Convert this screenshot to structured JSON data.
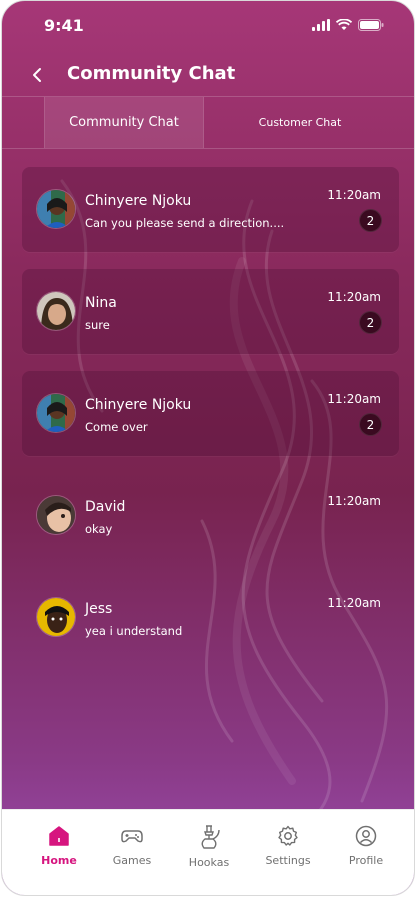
{
  "status": {
    "time": "9:41"
  },
  "header": {
    "title": "Community Chat"
  },
  "tabs": [
    {
      "label": "Community Chat",
      "active": true
    },
    {
      "label": "Customer Chat",
      "active": false
    }
  ],
  "chats": [
    {
      "name": "Chinyere Njoku",
      "message": "Can you please send a direction....",
      "time": "11:20am",
      "unread": "2"
    },
    {
      "name": "Nina",
      "message": "sure",
      "time": "11:20am",
      "unread": "2"
    },
    {
      "name": "Chinyere Njoku",
      "message": "Come  over",
      "time": "11:20am",
      "unread": "2"
    },
    {
      "name": "David",
      "message": "okay",
      "time": "11:20am",
      "unread": ""
    },
    {
      "name": "Jess",
      "message": "yea i understand",
      "time": "11:20am",
      "unread": ""
    }
  ],
  "nav": [
    {
      "label": "Home",
      "icon": "home-icon",
      "active": true
    },
    {
      "label": "Games",
      "icon": "gamepad-icon",
      "active": false
    },
    {
      "label": "Hookas",
      "icon": "hookah-icon",
      "active": false
    },
    {
      "label": "Settings",
      "icon": "gear-icon",
      "active": false
    },
    {
      "label": "Profile",
      "icon": "profile-icon",
      "active": false
    }
  ],
  "colors": {
    "accent": "#d6157f",
    "badge": "#3a0a20",
    "background_top": "#a63777",
    "background_bottom": "#9b4db0"
  }
}
